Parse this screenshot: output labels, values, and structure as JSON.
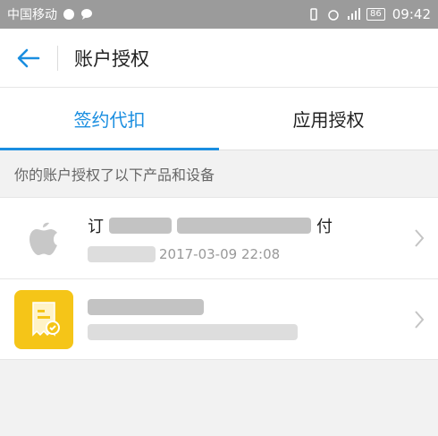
{
  "status_bar": {
    "carrier": "中国移动",
    "battery": "86",
    "time": "09:42"
  },
  "header": {
    "back_icon": "arrow-left-icon",
    "title": "账户授权"
  },
  "tabs": [
    {
      "label": "签约代扣",
      "active": true
    },
    {
      "label": "应用授权",
      "active": false
    }
  ],
  "section": {
    "heading": "你的账户授权了以下产品和设备"
  },
  "items": [
    {
      "logo": "apple-logo",
      "title_prefix": "订",
      "title_suffix": "付",
      "date": "2017-03-09 22:08"
    },
    {
      "logo": "yellow-receipt-logo",
      "title_prefix": "",
      "title_suffix": "",
      "date": ""
    }
  ],
  "colors": {
    "accent": "#1a8ee0",
    "status_bar": "#9b9b9b",
    "yellow": "#f5c518"
  }
}
